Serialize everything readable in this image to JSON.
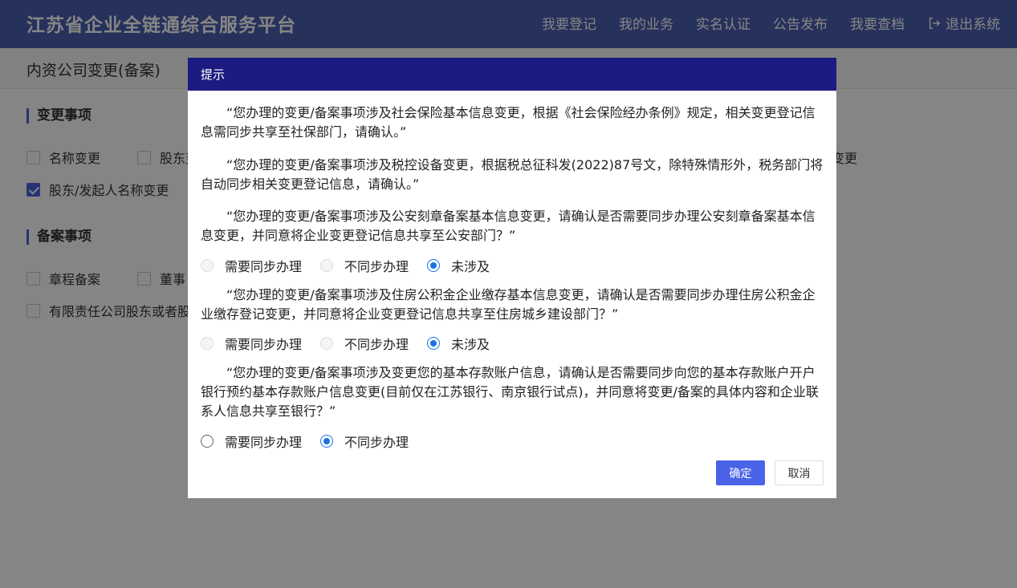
{
  "header": {
    "app_title": "江苏省企业全链通综合服务平台",
    "nav": [
      "我要登记",
      "我的业务",
      "实名认证",
      "公告发布",
      "我要查档"
    ],
    "logout": "退出系统"
  },
  "page_title": "内资公司变更(备案)",
  "change_section": {
    "title": "变更事项",
    "items": [
      {
        "label": "名称变更",
        "checked": false
      },
      {
        "label": "股东变",
        "checked": false
      },
      {
        "label": "变更",
        "checked": false
      },
      {
        "label": "股东/发起人名称变更",
        "checked": true
      }
    ]
  },
  "filing_section": {
    "title": "备案事项",
    "items": [
      {
        "label": "章程备案",
        "checked": false
      },
      {
        "label": "董事",
        "checked": false
      },
      {
        "label": "有限责任公司股东或者股",
        "checked": false
      }
    ]
  },
  "modal": {
    "title": "提示",
    "paragraphs": [
      "“您办理的变更/备案事项涉及社会保险基本信息变更，根据《社会保险经办条例》规定，相关变更登记信息需同步共享至社保部门，请确认。”",
      "“您办理的变更/备案事项涉及税控设备变更，根据税总征科发(2022)87号文，除特殊情形外，税务部门将自动同步相关变更登记信息，请确认。”",
      "“您办理的变更/备案事项涉及公安刻章备案基本信息变更，请确认是否需要同步办理公安刻章备案基本信息变更，并同意将企业变更登记信息共享至公安部门？”",
      "“您办理的变更/备案事项涉及住房公积金企业缴存基本信息变更，请确认是否需要同步办理住房公积金企业缴存登记变更，并同意将企业变更登记信息共享至住房城乡建设部门？”",
      "“您办理的变更/备案事项涉及变更您的基本存款账户信息，请确认是否需要同步向您的基本存款账户开户银行预约基本存款账户信息变更(目前仅在江苏银行、南京银行试点)，并同意将变更/备案的具体内容和企业联系人信息共享至银行？”"
    ],
    "options": {
      "need_sync": "需要同步办理",
      "no_sync": "不同步办理",
      "not_involved": "未涉及"
    },
    "police_selected": "未涉及",
    "fund_selected": "未涉及",
    "bank_selected": "不同步办理",
    "confirm_label": "确定",
    "cancel_label": "取消"
  },
  "colors": {
    "header_bg": "#4a5fb0",
    "modal_header_bg": "#1b1b82",
    "accent": "#4a63d8",
    "radio_active": "#1a73e8"
  }
}
